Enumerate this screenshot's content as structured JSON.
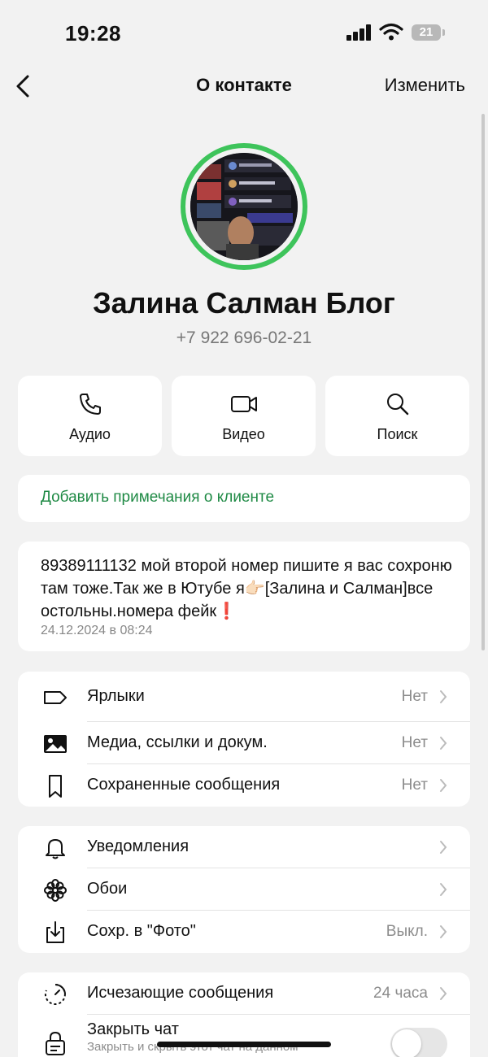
{
  "status": {
    "time": "19:28",
    "battery": "21"
  },
  "nav": {
    "title": "О контакте",
    "edit_label": "Изменить"
  },
  "contact": {
    "name": "Залина Салман Блог",
    "phone": "+7 922 696-02-21"
  },
  "actions": [
    {
      "label": "Аудио",
      "icon": "phone-icon"
    },
    {
      "label": "Видео",
      "icon": "video-camera-icon"
    },
    {
      "label": "Поиск",
      "icon": "search-icon"
    }
  ],
  "notes": {
    "label": "Добавить примечания о клиенте"
  },
  "about": {
    "text": "89389111132 мой второй номер пишите я вас сохроню там тоже.Так же в Ютубе я👉🏻[Залина и Салман]все остольны.номера фейк❗️",
    "date": "24.12.2024 в 08:24"
  },
  "section1": [
    {
      "title": "Ярлыки",
      "value": "Нет",
      "icon": "label-tag-icon"
    },
    {
      "title": "Медиа, ссылки и докум.",
      "value": "Нет",
      "icon": "photo-icon"
    },
    {
      "title": "Сохраненные сообщения",
      "value": "Нет",
      "icon": "bookmark-icon"
    }
  ],
  "section2": [
    {
      "title": "Уведомления",
      "value": "",
      "icon": "bell-icon"
    },
    {
      "title": "Обои",
      "value": "",
      "icon": "flower-icon"
    },
    {
      "title": "Сохр. в \"Фото\"",
      "value": "Выкл.",
      "icon": "save-download-icon"
    }
  ],
  "section3": [
    {
      "title": "Исчезающие сообщения",
      "value": "24 часа",
      "icon": "timer-icon"
    },
    {
      "title": "Закрыть чат",
      "subtitle": "Закрыть и скрыть этот чат на данном",
      "icon": "chat-lock-icon",
      "toggle_on": false
    }
  ],
  "colors": {
    "accent_green": "#3ec45b",
    "link_green": "#1f8a45",
    "background": "#f2f2f2"
  }
}
